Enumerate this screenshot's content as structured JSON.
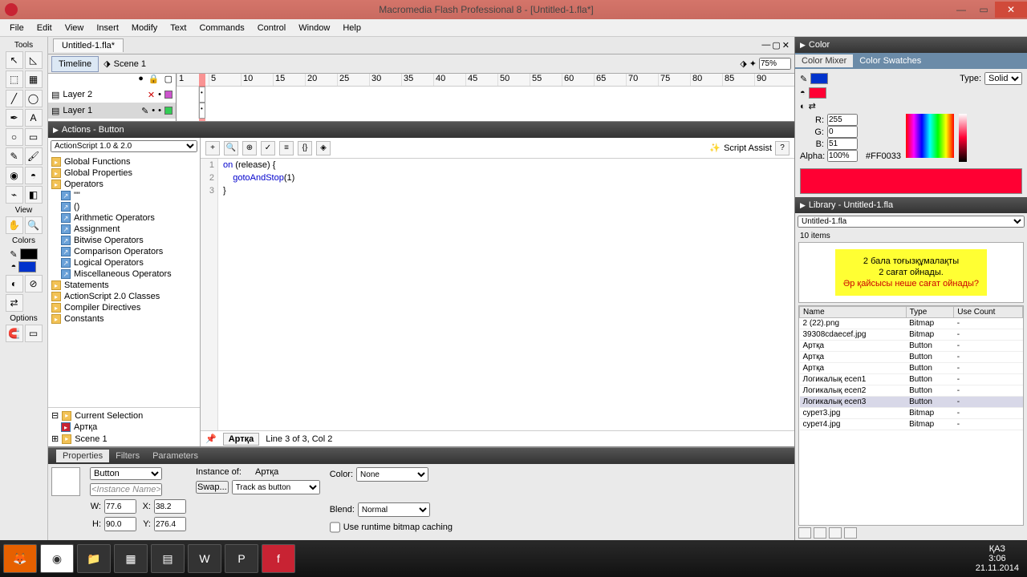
{
  "titlebar": {
    "title": "Macromedia Flash Professional 8 - [Untitled-1.fla*]"
  },
  "menu": [
    "File",
    "Edit",
    "View",
    "Insert",
    "Modify",
    "Text",
    "Commands",
    "Control",
    "Window",
    "Help"
  ],
  "tools": {
    "label": "Tools",
    "view_label": "View",
    "colors_label": "Colors",
    "options_label": "Options"
  },
  "doc": {
    "tab": "Untitled-1.fla*",
    "timeline_btn": "Timeline",
    "scene": "Scene 1",
    "zoom": "75%"
  },
  "layers": [
    {
      "name": "Layer 2",
      "color": "#cc55cc"
    },
    {
      "name": "Layer 1",
      "color": "#33cc55"
    }
  ],
  "ruler": [
    "1",
    "5",
    "10",
    "15",
    "20",
    "25",
    "30",
    "35",
    "40",
    "45",
    "50",
    "55",
    "60",
    "65",
    "70",
    "75",
    "80",
    "85",
    "90"
  ],
  "actions": {
    "title": "Actions - Button",
    "version_select": "ActionScript 1.0 & 2.0",
    "categories_top": [
      "Global Functions",
      "Global Properties",
      "Operators"
    ],
    "operators_sub": [
      "\"\"",
      "()",
      "Arithmetic Operators",
      "Assignment",
      "Bitwise Operators",
      "Comparison Operators",
      "Logical Operators",
      "Miscellaneous Operators"
    ],
    "categories_bottom": [
      "Statements",
      "ActionScript 2.0 Classes",
      "Compiler Directives",
      "Constants"
    ],
    "current_sel": "Current Selection",
    "artka": "Артқа",
    "scene1": "Scene 1",
    "pin": "Артқа",
    "status": "Line 3 of 3, Col 2",
    "script_assist": "Script Assist",
    "code": {
      "l1a": "on ",
      "l1b": "(release) {",
      "l2": "    gotoAndStop",
      "l2b": "(1)",
      "l3": "}"
    }
  },
  "props": {
    "tabs": [
      "Properties",
      "Filters",
      "Parameters"
    ],
    "type": "Button",
    "instance_placeholder": "<Instance Name>",
    "instance_of_label": "Instance of:",
    "instance_of": "Артқа",
    "swap": "Swap...",
    "track": "Track as button",
    "color_label": "Color:",
    "color_val": "None",
    "blend_label": "Blend:",
    "blend_val": "Normal",
    "cache": "Use runtime bitmap caching",
    "w": "77.6",
    "x": "38.2",
    "h": "90.0",
    "y": "276.4"
  },
  "color": {
    "panel_title": "Color",
    "tabs": [
      "Color Mixer",
      "Color Swatches"
    ],
    "type_label": "Type:",
    "type_val": "Solid",
    "r": "255",
    "g": "0",
    "b": "51",
    "alpha_label": "Alpha:",
    "alpha": "100%",
    "hex": "#FF0033"
  },
  "library": {
    "title": "Library - Untitled-1.fla",
    "doc": "Untitled-1.fla",
    "count": "10 items",
    "preview": {
      "line1": "2 бала тоғызқұмалақты",
      "line2": "2 сағат ойнады.",
      "line3": "Әр қайсысы неше сағат ойнады?"
    },
    "cols": [
      "Name",
      "Type",
      "Use Count"
    ],
    "items": [
      {
        "name": "2 (22).png",
        "type": "Bitmap",
        "use": "-"
      },
      {
        "name": "39308cdaecef.jpg",
        "type": "Bitmap",
        "use": "-"
      },
      {
        "name": "Артқа",
        "type": "Button",
        "use": "-"
      },
      {
        "name": "Артқа",
        "type": "Button",
        "use": "-"
      },
      {
        "name": "Артқа",
        "type": "Button",
        "use": "-"
      },
      {
        "name": "Логикалық есеп1",
        "type": "Button",
        "use": "-"
      },
      {
        "name": "Логикалық есеп2",
        "type": "Button",
        "use": "-"
      },
      {
        "name": "Логикалық есеп3",
        "type": "Button",
        "use": "-"
      },
      {
        "name": "сурет3.jpg",
        "type": "Bitmap",
        "use": "-"
      },
      {
        "name": "сурет4.jpg",
        "type": "Bitmap",
        "use": "-"
      }
    ]
  },
  "taskbar": {
    "lang": "ҚАЗ",
    "time": "3:06",
    "date": "21.11.2014"
  }
}
